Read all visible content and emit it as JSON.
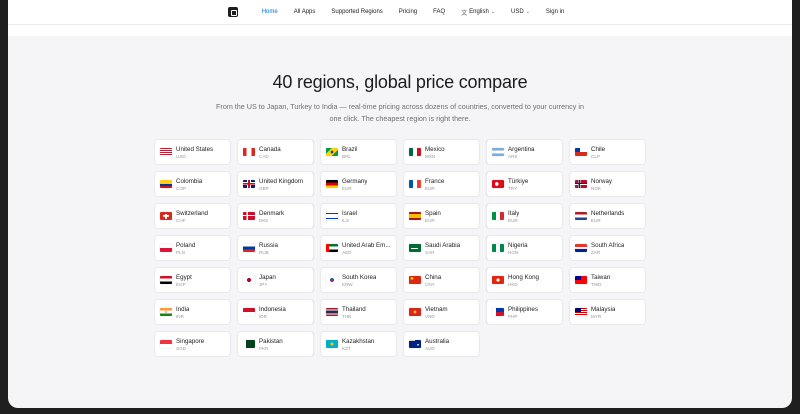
{
  "nav": {
    "items": [
      {
        "label": "Home",
        "active": true
      },
      {
        "label": "All Apps"
      },
      {
        "label": "Supported Regions"
      },
      {
        "label": "Pricing"
      },
      {
        "label": "FAQ"
      }
    ],
    "language": "English",
    "currency": "USD",
    "signin": "Sign in",
    "accent_color": "#0071e3"
  },
  "hero": {
    "title": "40 regions, global price compare",
    "subtitle": "From the US to Japan, Turkey to India — real-time pricing across dozens of countries, converted to your currency in one click. The cheapest region is right there."
  },
  "regions": [
    {
      "name": "United States",
      "code": "USD",
      "flag": "us"
    },
    {
      "name": "Canada",
      "code": "CAD",
      "flag": "ca"
    },
    {
      "name": "Brazil",
      "code": "BRL",
      "flag": "br"
    },
    {
      "name": "Mexico",
      "code": "MXN",
      "flag": "mx"
    },
    {
      "name": "Argentina",
      "code": "ARS",
      "flag": "ar"
    },
    {
      "name": "Chile",
      "code": "CLP",
      "flag": "cl"
    },
    {
      "name": "Colombia",
      "code": "COP",
      "flag": "co"
    },
    {
      "name": "United Kingdom",
      "code": "GBP",
      "flag": "gb"
    },
    {
      "name": "Germany",
      "code": "EUR",
      "flag": "de"
    },
    {
      "name": "France",
      "code": "EUR",
      "flag": "fr"
    },
    {
      "name": "Türkiye",
      "code": "TRY",
      "flag": "tr"
    },
    {
      "name": "Norway",
      "code": "NOK",
      "flag": "no"
    },
    {
      "name": "Switzerland",
      "code": "CHF",
      "flag": "ch"
    },
    {
      "name": "Denmark",
      "code": "DKK",
      "flag": "dk"
    },
    {
      "name": "Israel",
      "code": "ILS",
      "flag": "il"
    },
    {
      "name": "Spain",
      "code": "EUR",
      "flag": "es"
    },
    {
      "name": "Italy",
      "code": "EUR",
      "flag": "it"
    },
    {
      "name": "Netherlands",
      "code": "EUR",
      "flag": "nl"
    },
    {
      "name": "Poland",
      "code": "PLN",
      "flag": "pl"
    },
    {
      "name": "Russia",
      "code": "RUB",
      "flag": "ru"
    },
    {
      "name": "United Arab Em...",
      "code": "AED",
      "flag": "ae"
    },
    {
      "name": "Saudi Arabia",
      "code": "SAR",
      "flag": "sa"
    },
    {
      "name": "Nigeria",
      "code": "NGN",
      "flag": "ng"
    },
    {
      "name": "South Africa",
      "code": "ZAR",
      "flag": "za"
    },
    {
      "name": "Egypt",
      "code": "EGP",
      "flag": "eg"
    },
    {
      "name": "Japan",
      "code": "JPY",
      "flag": "jp"
    },
    {
      "name": "South Korea",
      "code": "KRW",
      "flag": "kr"
    },
    {
      "name": "China",
      "code": "CNY",
      "flag": "cn"
    },
    {
      "name": "Hong Kong",
      "code": "HKD",
      "flag": "hk"
    },
    {
      "name": "Taiwan",
      "code": "TWD",
      "flag": "tw"
    },
    {
      "name": "India",
      "code": "INR",
      "flag": "in"
    },
    {
      "name": "Indonesia",
      "code": "IDR",
      "flag": "id"
    },
    {
      "name": "Thailand",
      "code": "THB",
      "flag": "th"
    },
    {
      "name": "Vietnam",
      "code": "VND",
      "flag": "vn"
    },
    {
      "name": "Philippines",
      "code": "PHP",
      "flag": "ph"
    },
    {
      "name": "Malaysia",
      "code": "MYR",
      "flag": "my"
    },
    {
      "name": "Singapore",
      "code": "SGD",
      "flag": "sg"
    },
    {
      "name": "Pakistan",
      "code": "PKR",
      "flag": "pk"
    },
    {
      "name": "Kazakhstan",
      "code": "KZT",
      "flag": "kz"
    },
    {
      "name": "Australia",
      "code": "AUD",
      "flag": "au"
    }
  ]
}
